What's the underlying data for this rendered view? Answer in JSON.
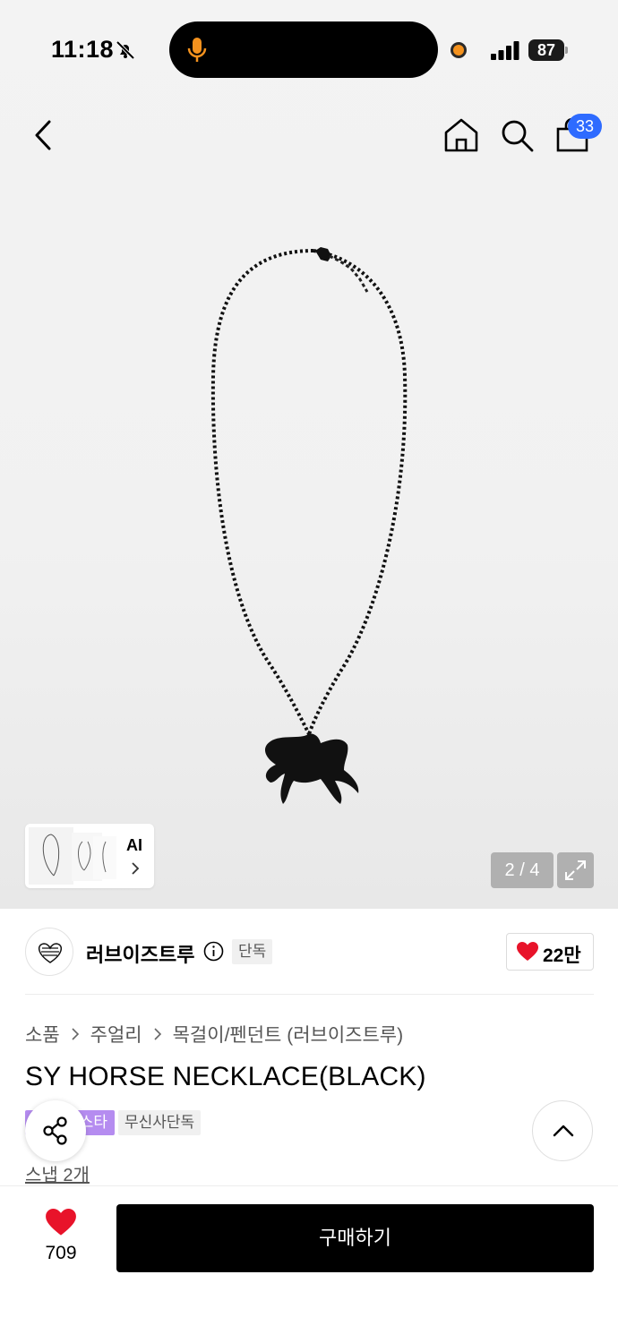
{
  "status_bar": {
    "time": "11:18",
    "battery": "87"
  },
  "nav": {
    "cart_count": "33"
  },
  "gallery": {
    "ai_label": "AI",
    "counter": "2 / 4"
  },
  "brand": {
    "name": "러브이즈트루",
    "exclusive_tag": "단독",
    "likes": "22만"
  },
  "breadcrumb": {
    "items": [
      "소품",
      "주얼리",
      "목걸이/펜던트 (러브이즈트루)"
    ]
  },
  "product": {
    "title": "SY HORSE NECKLACE(BLACK)",
    "badge_purple": "스타",
    "badge_gray": "무신사단독",
    "snap": "스냅 2개"
  },
  "bottom_bar": {
    "likes": "709",
    "buy_label": "구매하기"
  },
  "colors": {
    "accent_blue": "#2e6bff",
    "heart_red": "#e8132a",
    "badge_purple": "#b58cf0"
  }
}
